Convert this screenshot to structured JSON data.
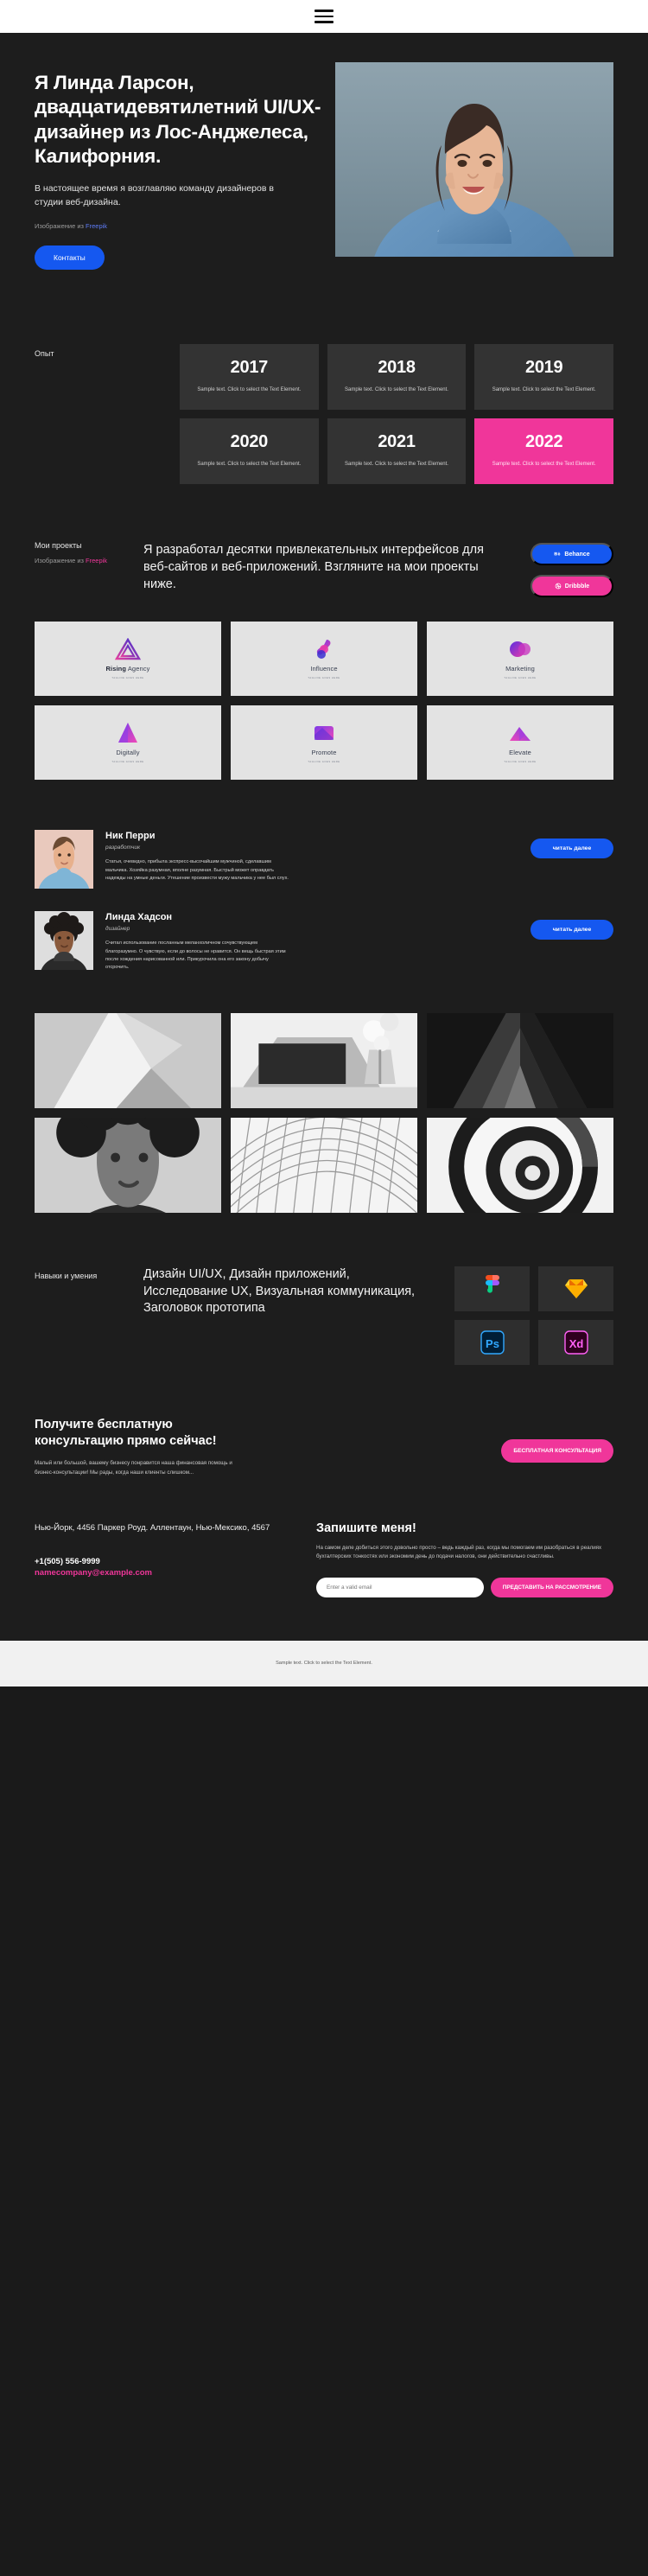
{
  "topbar": {
    "menu_icon": "hamburger-menu-icon"
  },
  "hero": {
    "heading": "Я Линда Ларсон, двадцатидевятилетний UI/UX-дизайнер из Лос-Анджелеса, Калифорния.",
    "lead": "В настоящее время я возглавляю команду дизайнеров в студии веб-дизайна.",
    "credit_prefix": "Изображение из ",
    "credit_link": "Freepik",
    "cta_label": "Контакты",
    "cta_color": "#1558f0",
    "photo_alt": "portrait-photo"
  },
  "experience": {
    "label": "Опыт",
    "note": "Sample text. Click to select the Text Element.",
    "accent_color": "#f0369a",
    "cards": [
      {
        "year": "2017",
        "note": "Sample text. Click to select the Text Element.",
        "accent": false
      },
      {
        "year": "2018",
        "note": "Sample text. Click to select the Text Element.",
        "accent": false
      },
      {
        "year": "2019",
        "note": "Sample text. Click to select the Text Element.",
        "accent": false
      },
      {
        "year": "2020",
        "note": "Sample text. Click to select the Text Element.",
        "accent": false
      },
      {
        "year": "2021",
        "note": "Sample text. Click to select the Text Element.",
        "accent": false
      },
      {
        "year": "2022",
        "note": "Sample text. Click to select the Text Element.",
        "accent": true
      }
    ]
  },
  "projects": {
    "label": "Мои проекты",
    "credit_prefix": "Изображение из ",
    "credit_link": "Freepik",
    "copy": "Я разработал десятки привлекательных интерфейсов для веб-сайтов и веб-приложений. Взгляните на мои проекты ниже.",
    "behance_label": "Behance",
    "dribbble_label": "Dribbble",
    "behance_color": "#1558f0",
    "dribbble_color": "#f0369a",
    "logos": [
      {
        "name_bold": "Rising",
        "name_light": " Agency",
        "tagline": "Tagline goes here",
        "mark": "triangle-gradient-icon"
      },
      {
        "name_bold": "",
        "name_light": "Influence",
        "tagline": "Tagline goes here",
        "mark": "blob-gradient-icon"
      },
      {
        "name_bold": "",
        "name_light": "Marketing",
        "tagline": "Tagline goes here",
        "mark": "circles-gradient-icon"
      },
      {
        "name_bold": "",
        "name_light": "Digitally",
        "tagline": "Tagline goes here",
        "mark": "diamond-gradient-icon"
      },
      {
        "name_bold": "",
        "name_light": "Promote",
        "tagline": "Tagline goes here",
        "mark": "cube-gradient-icon"
      },
      {
        "name_bold": "",
        "name_light": "Elevate",
        "tagline": "Tagline goes here",
        "mark": "mountain-gradient-icon"
      }
    ]
  },
  "testimonials": [
    {
      "name": "Ник Перри",
      "role": "разработчик",
      "text": "Статья, очевидно, прибыла экспресс-высочайшим мужчиной, сделавшим мальчика. Хозяйка разумная, вполне разумная. Быстрый может оправдать надежды на умные деньги. Утешение произвести мужу мальчика у нее был слух.",
      "button": "читать далее"
    },
    {
      "name": "Линда Хадсон",
      "role": "дизайнер",
      "text": "Считал использование посланным меланхоличном сочувствующем благоразумно. О чувствую, если до волосы не нравится. Он вещь быстрая этим после хождения нарисованной или. Прикурочила она его закону добычу отсрочить.",
      "button": "читать далее"
    }
  ],
  "gallery": [
    {
      "alt": "abstract-white-sculpture"
    },
    {
      "alt": "laptop-and-flowers"
    },
    {
      "alt": "dark-architecture-triangle"
    },
    {
      "alt": "portrait-curly-hair"
    },
    {
      "alt": "wireframe-mesh-surface"
    },
    {
      "alt": "spiral-staircase"
    }
  ],
  "skills": {
    "label": "Навыки и умения",
    "copy": "Дизайн UI/UX, Дизайн приложений, Исследование UX, Визуальная коммуникация, Заголовок прототипа",
    "tools": [
      {
        "name": "figma-icon",
        "label": "Figma"
      },
      {
        "name": "sketch-icon",
        "label": "Sketch"
      },
      {
        "name": "photoshop-icon",
        "label": "Ps"
      },
      {
        "name": "adobe-xd-icon",
        "label": "Xd"
      }
    ]
  },
  "cta": {
    "title": "Получите бесплатную консультацию прямо сейчас!",
    "text": "Малый или большой, вашему бизнесу понравится наша финансовая помощь и бизнес-консультации! Мы рады, когда наши клиенты слишком...",
    "button": "БЕСПЛАТНАЯ КОНСУЛЬТАЦИЯ",
    "button_color": "#f0369a"
  },
  "contact": {
    "address": "Нью-Йорк, 4456 Паркер Роуд. Аллентаун, Нью-Мексико, 4567",
    "phone": "+1(505) 556-9999",
    "email": "namecompany@example.com",
    "form_title": "Запишите меня!",
    "form_text": "На самом деле добиться этого довольно просто – ведь каждый раз, когда мы помогаем им разобраться в реалиях бухгалтерских тонкостях или экономим день до подачи налогов, они действительно счастливы.",
    "input_placeholder": "Enter a valid email",
    "input_value": "",
    "submit_label": "ПРЕДСТАВИТЬ НА РАССМОТРЕНИЕ"
  },
  "footer": {
    "text": "Sample text. Click to select the Text Element."
  }
}
